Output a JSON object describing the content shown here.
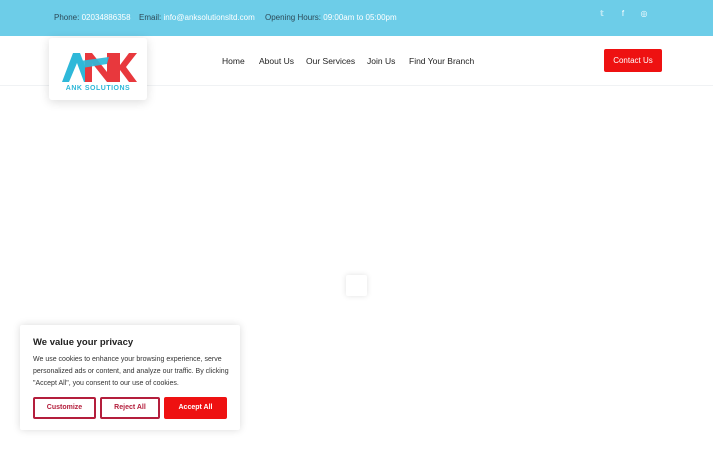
{
  "topbar": {
    "phone_label": "Phone:",
    "phone_value": "02034886358",
    "email_label": "Email:",
    "email_value": "info@anksolutionsltd.com",
    "hours_label": "Opening Hours:",
    "hours_value": "09:00am to 05:00pm",
    "social": [
      {
        "icon": "twitter-icon",
        "glyph": "𝕥"
      },
      {
        "icon": "facebook-icon",
        "glyph": "f"
      },
      {
        "icon": "instagram-icon",
        "glyph": "◎"
      }
    ]
  },
  "logo": {
    "letters": "ANK",
    "tagline": "ANK SOLUTIONS",
    "colors": {
      "a": "#2eb8d9",
      "n": "#e8383d",
      "k": "#e8383d",
      "tagline": "#2eb8d9"
    }
  },
  "nav": {
    "home": "Home",
    "about": "About Us",
    "services": "Our Services",
    "join": "Join Us",
    "branch": "Find Your Branch"
  },
  "contact_button": "Contact Us",
  "cookie": {
    "title": "We value your privacy",
    "text": "We use cookies to enhance your browsing experience, serve personalized ads or content, and analyze our traffic. By clicking \"Accept All\", you consent to our use of cookies.",
    "customize": "Customize",
    "reject": "Reject All",
    "accept": "Accept All"
  },
  "colors": {
    "topbar": "#6dcde8",
    "accent_red": "#ee1111",
    "outline_red": "#b41e3c"
  }
}
